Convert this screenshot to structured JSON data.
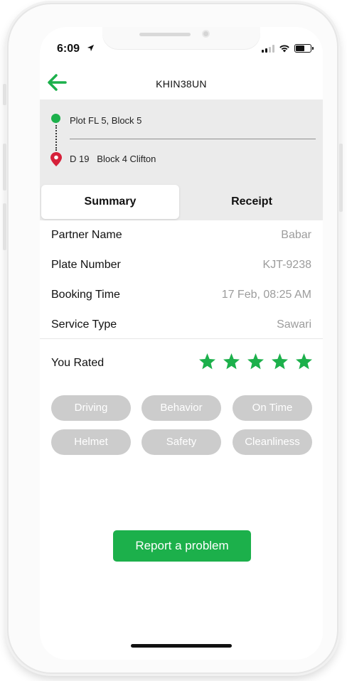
{
  "status_bar": {
    "time": "6:09"
  },
  "header": {
    "title": "KHIN38UN"
  },
  "route": {
    "pickup": "Plot FL 5, Block 5",
    "dropoff": "D 19   Block 4 Clifton"
  },
  "tabs": [
    {
      "label": "Summary"
    },
    {
      "label": "Receipt"
    }
  ],
  "details": [
    {
      "label": "Partner Name",
      "value": "Babar"
    },
    {
      "label": "Plate Number",
      "value": "KJT-9238"
    },
    {
      "label": "Booking Time",
      "value": "17 Feb, 08:25 AM"
    },
    {
      "label": "Service Type",
      "value": "Sawari"
    }
  ],
  "rating": {
    "label": "You Rated",
    "stars": 5,
    "max": 5
  },
  "chips": [
    {
      "label": "Driving"
    },
    {
      "label": "Behavior"
    },
    {
      "label": "On Time"
    },
    {
      "label": "Helmet"
    },
    {
      "label": "Safety"
    },
    {
      "label": "Cleanliness"
    }
  ],
  "actions": {
    "report_label": "Report a problem"
  },
  "colors": {
    "accent": "#1cb04b",
    "destination_pin": "#d6203a",
    "chip_bg": "#cccccc",
    "route_bg": "#ebebeb"
  },
  "icons": {
    "back": "arrow-left-icon",
    "location": "location-arrow-icon",
    "wifi": "wifi-icon",
    "battery": "battery-icon",
    "star": "star-icon"
  }
}
